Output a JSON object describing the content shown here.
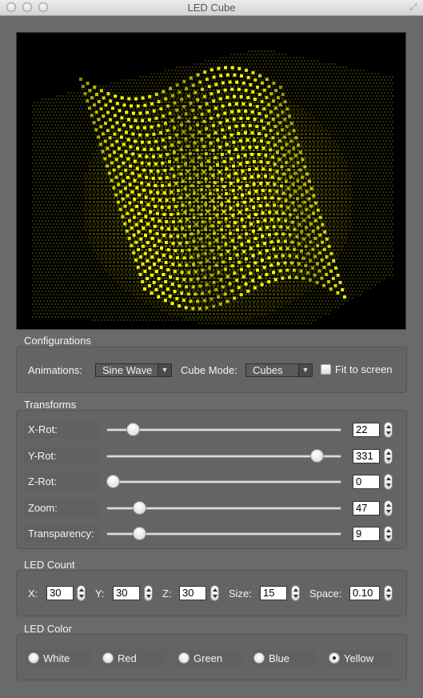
{
  "window": {
    "title": "LED Cube"
  },
  "configurations": {
    "title": "Configurations",
    "animations_label": "Animations:",
    "animation_value": "Sine Wave",
    "cube_mode_label": "Cube Mode:",
    "cube_mode_value": "Cubes",
    "fit_label": "Fit to screen",
    "fit_checked": false
  },
  "transforms": {
    "title": "Transforms",
    "rows": [
      {
        "label": "X-Rot:",
        "value": "22",
        "slider": 0.09
      },
      {
        "label": "Y-Rot:",
        "value": "331",
        "slider": 0.92
      },
      {
        "label": "Z-Rot:",
        "value": "0",
        "slider": 0.0
      },
      {
        "label": "Zoom:",
        "value": "47",
        "slider": 0.12
      },
      {
        "label": "Transparency:",
        "value": "9",
        "slider": 0.12
      }
    ]
  },
  "led_count": {
    "title": "LED Count",
    "x_label": "X:",
    "x_value": "30",
    "y_label": "Y:",
    "y_value": "30",
    "z_label": "Z:",
    "z_value": "30",
    "size_label": "Size:",
    "size_value": "15",
    "space_label": "Space:",
    "space_value": "0.10"
  },
  "led_color": {
    "title": "LED Color",
    "options": [
      "White",
      "Red",
      "Green",
      "Blue",
      "Yellow"
    ],
    "selected": "Yellow",
    "color_hex": "#ffff00"
  }
}
